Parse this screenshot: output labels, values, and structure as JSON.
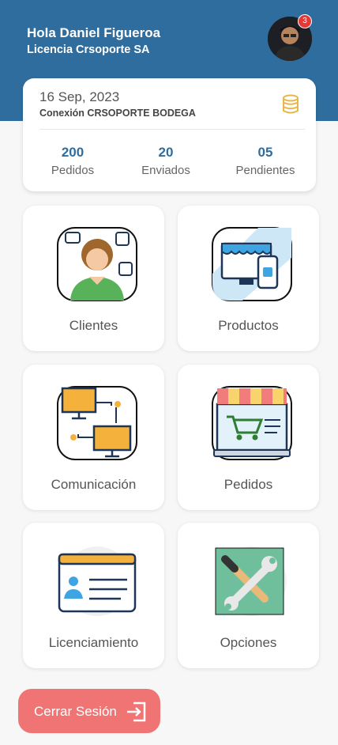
{
  "header": {
    "greeting": "Hola Daniel Figueroa",
    "license": "Licencia Crsoporte SA",
    "notification_count": "3"
  },
  "info": {
    "date": "16 Sep, 2023",
    "connection": "Conexión CRSOPORTE BODEGA",
    "stats": [
      {
        "value": "200",
        "label": "Pedidos"
      },
      {
        "value": "20",
        "label": "Enviados"
      },
      {
        "value": "05",
        "label": "Pendientes"
      }
    ]
  },
  "menu": [
    {
      "label": "Clientes",
      "icon": "customer-support-icon"
    },
    {
      "label": "Productos",
      "icon": "store-icon"
    },
    {
      "label": "Comunicación",
      "icon": "network-icon"
    },
    {
      "label": "Pedidos",
      "icon": "shopping-cart-icon"
    },
    {
      "label": "Licenciamiento",
      "icon": "id-card-icon"
    },
    {
      "label": "Opciones",
      "icon": "tools-icon"
    }
  ],
  "logout_label": "Cerrar Sesión",
  "colors": {
    "header": "#2f6d9e",
    "accent": "#2f6d9e",
    "logout": "#f07474"
  }
}
